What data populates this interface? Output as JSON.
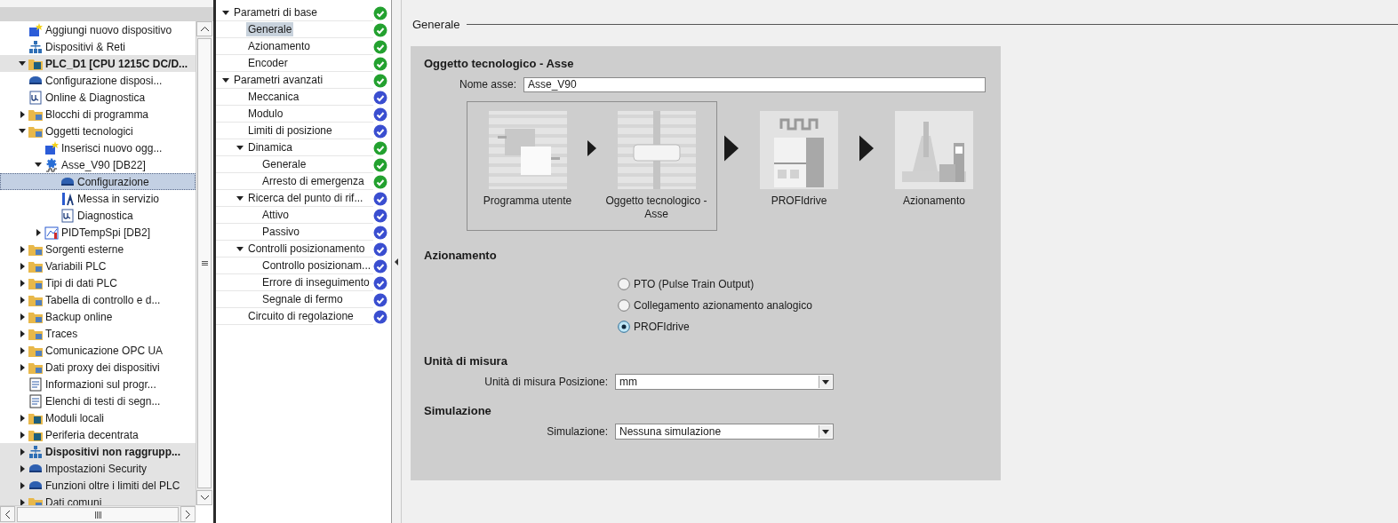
{
  "project_tree": {
    "items": [
      {
        "label": "Aggiungi nuovo dispositivo",
        "kind": "add"
      },
      {
        "label": "Dispositivi & Reti",
        "kind": "network"
      },
      {
        "label": "PLC_D1 [CPU 1215C DC/D...",
        "kind": "device",
        "bold": true,
        "expanded": true,
        "children": [
          {
            "label": "Configurazione disposi...",
            "kind": "config"
          },
          {
            "label": "Online & Diagnostica",
            "kind": "diag"
          },
          {
            "label": "Blocchi di programma",
            "kind": "folder",
            "expanded": false
          },
          {
            "label": "Oggetti tecnologici",
            "kind": "folder",
            "expanded": true,
            "children": [
              {
                "label": "Inserisci nuovo ogg...",
                "kind": "add"
              },
              {
                "label": "Asse_V90 [DB22]",
                "kind": "gear",
                "expanded": true,
                "children": [
                  {
                    "label": "Configurazione",
                    "kind": "config",
                    "selected": true
                  },
                  {
                    "label": "Messa in servizio",
                    "kind": "tool",
                    "selected": false
                  },
                  {
                    "label": "Diagnostica",
                    "kind": "diag",
                    "selected": false
                  }
                ]
              },
              {
                "label": "PIDTempSpi [DB2]",
                "kind": "chart",
                "expanded": false
              }
            ]
          },
          {
            "label": "Sorgenti esterne",
            "kind": "folder",
            "expanded": false
          },
          {
            "label": "Variabili PLC",
            "kind": "folder",
            "expanded": false
          },
          {
            "label": "Tipi di dati PLC",
            "kind": "folder",
            "expanded": false
          },
          {
            "label": "Tabella di controllo e d...",
            "kind": "folder",
            "expanded": false
          },
          {
            "label": "Backup online",
            "kind": "folder",
            "expanded": false
          },
          {
            "label": "Traces",
            "kind": "folder",
            "expanded": false
          },
          {
            "label": "Comunicazione OPC UA",
            "kind": "folder",
            "expanded": false
          },
          {
            "label": "Dati proxy dei dispositivi",
            "kind": "folder",
            "expanded": false
          },
          {
            "label": "Informazioni sul progr...",
            "kind": "doc"
          },
          {
            "label": "Elenchi di testi di segn...",
            "kind": "doc"
          },
          {
            "label": "Moduli locali",
            "kind": "device",
            "expanded": false
          },
          {
            "label": "Periferia decentrata",
            "kind": "device",
            "expanded": false
          }
        ]
      },
      {
        "label": "Dispositivi non raggrupp...",
        "kind": "network",
        "bold": true,
        "expanded": false
      },
      {
        "label": "Impostazioni Security",
        "kind": "config",
        "expanded": false
      },
      {
        "label": "Funzioni oltre i limiti del PLC",
        "kind": "config",
        "expanded": false
      },
      {
        "label": "Dati comuni",
        "kind": "folder",
        "expanded": false
      }
    ]
  },
  "navigation": {
    "items": [
      {
        "label": "Parametri di base",
        "color": "#23a12f",
        "expanded": true,
        "selected": false,
        "children": [
          {
            "label": "Generale",
            "color": "#23a12f",
            "selected": true
          },
          {
            "label": "Azionamento",
            "color": "#23a12f",
            "selected": false
          },
          {
            "label": "Encoder",
            "color": "#23a12f",
            "selected": false
          }
        ]
      },
      {
        "label": "Parametri avanzati",
        "color": "#23a12f",
        "expanded": true,
        "selected": false,
        "children": [
          {
            "label": "Meccanica",
            "color": "#3a4ed0",
            "selected": false
          },
          {
            "label": "Modulo",
            "color": "#3a4ed0",
            "selected": false
          },
          {
            "label": "Limiti di posizione",
            "color": "#3a4ed0",
            "selected": false
          },
          {
            "label": "Dinamica",
            "color": "#23a12f",
            "expanded": true,
            "selected": false,
            "children": [
              {
                "label": "Generale",
                "color": "#23a12f",
                "selected": false
              },
              {
                "label": "Arresto di emergenza",
                "color": "#23a12f",
                "selected": false
              }
            ]
          },
          {
            "label": "Ricerca del punto di rif...",
            "color": "#3a4ed0",
            "expanded": true,
            "selected": false,
            "children": [
              {
                "label": "Attivo",
                "color": "#3a4ed0",
                "selected": false
              },
              {
                "label": "Passivo",
                "color": "#3a4ed0",
                "selected": false
              }
            ]
          },
          {
            "label": "Controlli posizionamento",
            "color": "#3a4ed0",
            "expanded": true,
            "selected": false,
            "children": [
              {
                "label": "Controllo posizionam...",
                "color": "#3a4ed0",
                "selected": false
              },
              {
                "label": "Errore di inseguimento",
                "color": "#3a4ed0",
                "selected": false
              },
              {
                "label": "Segnale di fermo",
                "color": "#3a4ed0",
                "selected": false
              }
            ]
          },
          {
            "label": "Circuito di regolazione",
            "color": "#3a4ed0",
            "selected": false
          }
        ]
      }
    ]
  },
  "content": {
    "title": "Generale",
    "technology_object": {
      "heading": "Oggetto tecnologico - Asse",
      "name_label": "Nome asse:",
      "name_value": "Asse_V90",
      "flow": [
        {
          "label": "Programma utente",
          "grouped": true
        },
        {
          "label": "Oggetto tecnologico - Asse",
          "grouped": true
        },
        {
          "label": "PROFIdrive",
          "grouped": false
        },
        {
          "label": "Azionamento",
          "grouped": false
        }
      ]
    },
    "drive": {
      "heading": "Azionamento",
      "options": [
        {
          "label": "PTO (Pulse Train Output)",
          "selected": false
        },
        {
          "label": "Collegamento azionamento analogico",
          "selected": false
        },
        {
          "label": "PROFIdrive",
          "selected": true
        }
      ]
    },
    "units": {
      "heading": "Unità di misura",
      "label": "Unità di misura Posizione:",
      "value": "mm"
    },
    "simulation": {
      "heading": "Simulazione",
      "label": "Simulazione:",
      "value": "Nessuna simulazione"
    }
  }
}
